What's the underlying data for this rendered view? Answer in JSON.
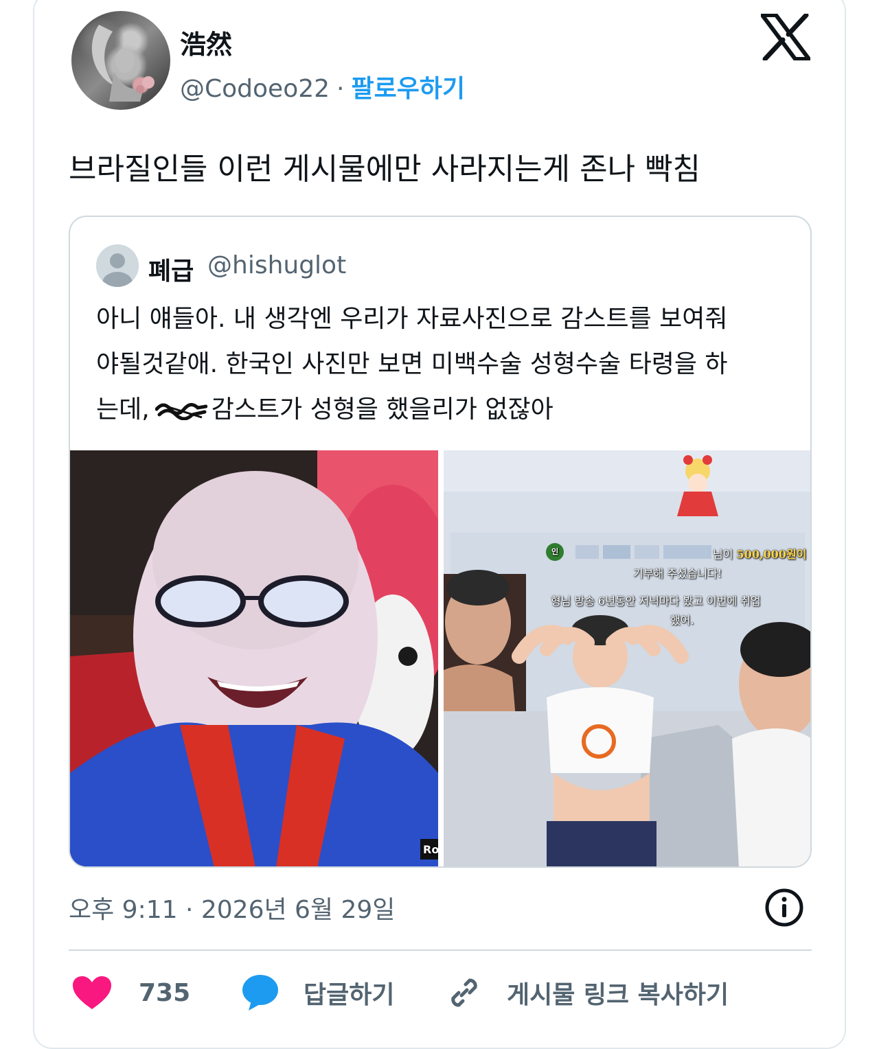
{
  "tweet": {
    "author_name": "浩然",
    "author_handle": "@Codoeo22",
    "separator": "·",
    "follow_label": "팔로우하기",
    "text": "브라질인들 이런 게시물에만 사라지는게 존나 빡침",
    "timestamp": "오후 9:11 · 2026년 6월 29일"
  },
  "quoted": {
    "author_name": "폐급",
    "author_handle": "@hishuglot",
    "lines": [
      "아니 얘들아. 내 생각엔 우리가 자료사진으로 감스트를 보여줘",
      "야될것같애. 한국인 사진만 보면 미백수술 성형수술 타령을 하",
      "는데,",
      "감스트가 성형을 했을리가 없잖아"
    ],
    "media_overlay": {
      "badge": "인",
      "donation_suffix": "님이",
      "donation_amount": "500,000원이",
      "line2": "기부해 주셨습니다!",
      "line3": "형님 방송 6년동안 저녁마다 봤고 이번에 취업",
      "line4": "했어.",
      "corner_text": "Ro"
    }
  },
  "actions": {
    "like_count": "735",
    "reply_label": "답글하기",
    "copy_link_label": "게시물 링크 복사하기"
  },
  "icons": {
    "brand": "x-logo-icon",
    "info": "info-icon",
    "like": "heart-icon",
    "reply": "speech-bubble-icon",
    "link": "link-icon"
  },
  "colors": {
    "accent": "#1d9bf0",
    "like": "#f91880",
    "text": "#0f1419",
    "secondary": "#536471",
    "border": "#cfd9de"
  }
}
